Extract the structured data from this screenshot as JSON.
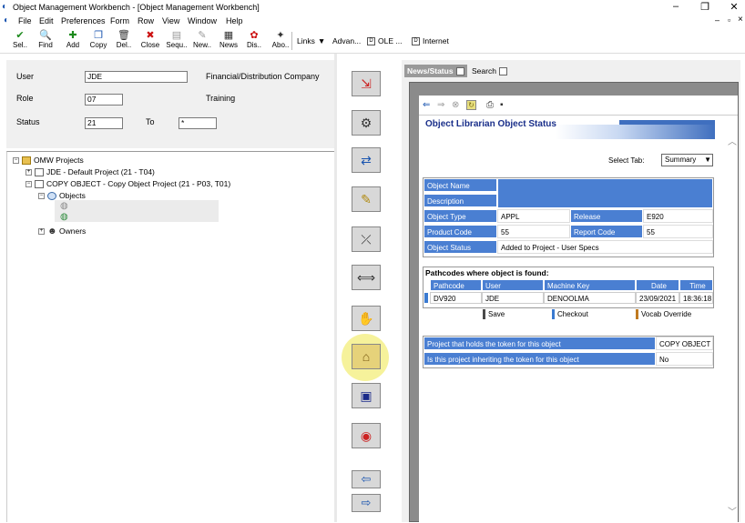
{
  "window": {
    "title": "Object Management Workbench - [Object Management Workbench]",
    "controls": {
      "minimize": "–",
      "restore": "❐",
      "close": "✕"
    },
    "inner_controls": {
      "minimize": "–",
      "restore": "▫",
      "close": "×"
    }
  },
  "menu": [
    "File",
    "Edit",
    "Preferences",
    "Form",
    "Row",
    "View",
    "Window",
    "Help"
  ],
  "toolbar": {
    "buttons": [
      {
        "label": "Sel..",
        "icon": "checkmark-icon",
        "glyph": "✔",
        "color": "#1c8a1c"
      },
      {
        "label": "Find",
        "icon": "find-icon",
        "glyph": "🔍",
        "color": "#333333"
      },
      {
        "label": "Add",
        "icon": "add-icon",
        "glyph": "✚",
        "color": "#1c8a1c"
      },
      {
        "label": "Copy",
        "icon": "copy-icon",
        "glyph": "❐",
        "color": "#1a55b0"
      },
      {
        "label": "Del..",
        "icon": "delete-icon",
        "glyph": "🗑",
        "color": "#333333"
      },
      {
        "label": "Close",
        "icon": "close-icon",
        "glyph": "✖",
        "color": "#cc1111"
      },
      {
        "label": "Sequ..",
        "icon": "sequence-icon",
        "glyph": "▤",
        "color": "#999999"
      },
      {
        "label": "New..",
        "icon": "new-icon",
        "glyph": "✎",
        "color": "#999999"
      },
      {
        "label": "News",
        "icon": "news-icon",
        "glyph": "▦",
        "color": "#333333"
      },
      {
        "label": "Dis..",
        "icon": "display-icon",
        "glyph": "✿",
        "color": "#cc1111"
      },
      {
        "label": "Abo..",
        "icon": "about-icon",
        "glyph": "✦",
        "color": "#333333"
      }
    ],
    "links_label": "Links",
    "advan_label": "Advan...",
    "ole_label": "OLE ...",
    "internet_label": "Internet"
  },
  "form": {
    "user_label": "User",
    "user_value": "JDE",
    "user_desc": "Financial/Distribution Company",
    "role_label": "Role",
    "role_value": "07",
    "role_desc": "Training",
    "status_label": "Status",
    "status_value": "21",
    "to_label": "To",
    "to_value": "*"
  },
  "tree": {
    "root": "OMW Projects",
    "items": [
      "JDE - Default Project (21 - T04)",
      "COPY OBJECT - Copy Object Project (21 - P03, T01)",
      "Objects",
      "Owners"
    ]
  },
  "mid_buttons": [
    "advance-project-icon",
    "design-icon",
    "transfer-icon",
    "edit-icon",
    "remove-icon",
    "move-icon",
    "checkout-hand-icon",
    "token-icon",
    "save-disk-icon",
    "restore-icon",
    "left-arrow-icon",
    "right-arrow-icon"
  ],
  "right": {
    "tabs": [
      "News/Status",
      "Search"
    ],
    "nav_icons": [
      "back-icon",
      "forward-icon",
      "stop-icon",
      "refresh-icon",
      "print-icon",
      "save-icon"
    ],
    "header_title": "Object Librarian Object Status",
    "select_tab_label": "Select Tab:",
    "select_tab_value": "Summary",
    "fields": {
      "object_name_label": "Object Name",
      "object_name_value": "",
      "description_label": "Description",
      "description_value": "",
      "object_type_label": "Object Type",
      "object_type_value": "APPL",
      "release_label": "Release",
      "release_value": "E920",
      "product_code_label": "Product Code",
      "product_code_value": "55",
      "report_code_label": "Report Code",
      "report_code_value": "55",
      "object_status_label": "Object Status",
      "object_status_value": "Added to Project - User Specs"
    },
    "pathcodes": {
      "title": "Pathcodes where object is found:",
      "headers": [
        "Pathcode",
        "User",
        "Machine Key",
        "Date",
        "Time"
      ],
      "rows": [
        [
          "DV920",
          "JDE",
          "DENOOLMA",
          "23/09/2021",
          "18:36:18"
        ]
      ],
      "legend": [
        {
          "label": "Save",
          "color": "#4a4a4a"
        },
        {
          "label": "Checkout",
          "color": "#3a7ad0"
        },
        {
          "label": "Vocab Override",
          "color": "#c07a20"
        }
      ]
    },
    "token": {
      "holds_label": "Project that holds the token for this object",
      "holds_value": "COPY OBJECT",
      "inherit_label": "Is this project inheriting the token for this object",
      "inherit_value": "No"
    }
  }
}
